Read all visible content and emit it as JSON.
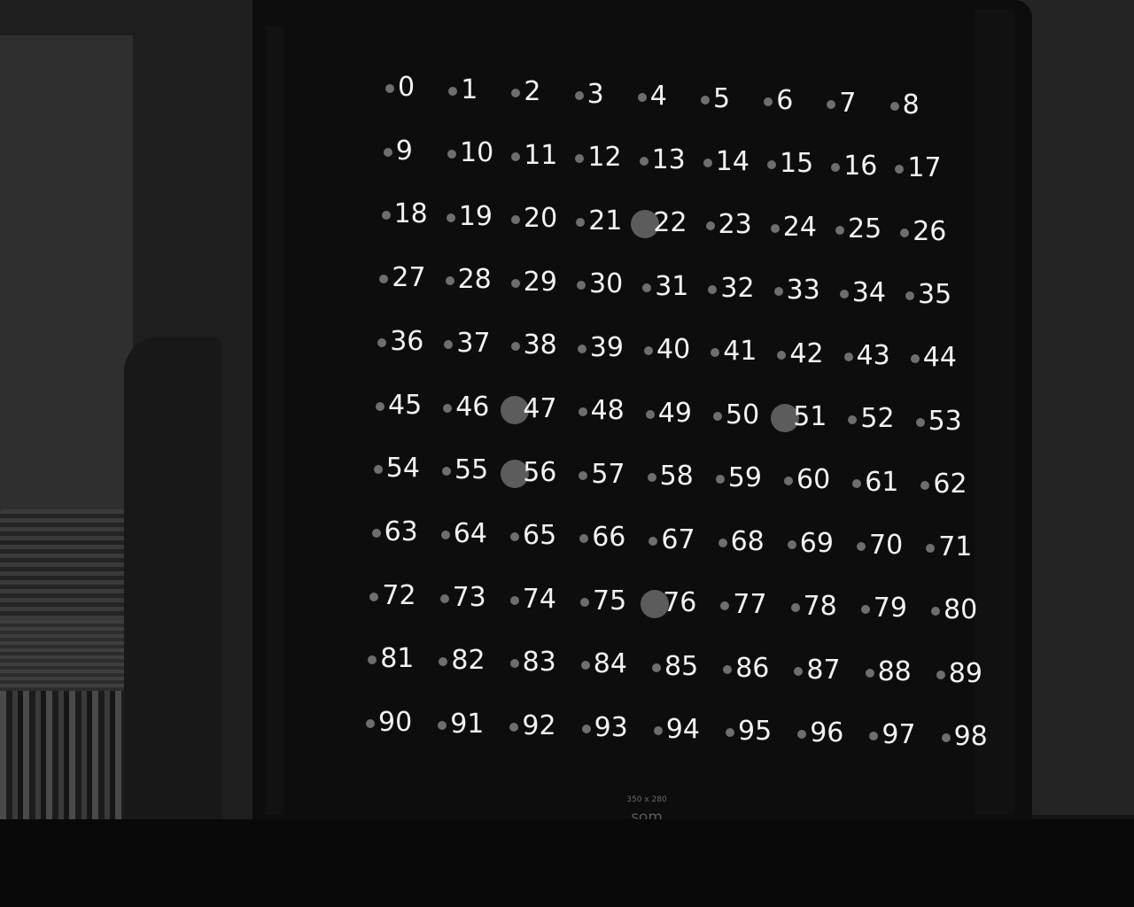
{
  "labels": [
    "0",
    "1",
    "2",
    "3",
    "4",
    "5",
    "6",
    "7",
    "8",
    "9",
    "10",
    "11",
    "12",
    "13",
    "14",
    "15",
    "16",
    "17",
    "18",
    "19",
    "20",
    "21",
    "22",
    "23",
    "24",
    "25",
    "26",
    "27",
    "28",
    "29",
    "30",
    "31",
    "32",
    "33",
    "34",
    "35",
    "36",
    "37",
    "38",
    "39",
    "40",
    "41",
    "42",
    "43",
    "44",
    "45",
    "46",
    "47",
    "48",
    "49",
    "50",
    "51",
    "52",
    "53",
    "54",
    "55",
    "56",
    "57",
    "58",
    "59",
    "60",
    "61",
    "62",
    "63",
    "64",
    "65",
    "66",
    "67",
    "68",
    "69",
    "70",
    "71",
    "72",
    "73",
    "74",
    "75",
    "76",
    "77",
    "78",
    "79",
    "80",
    "81",
    "82",
    "83",
    "84",
    "85",
    "86",
    "87",
    "88",
    "89",
    "90",
    "91",
    "92",
    "93",
    "94",
    "95",
    "96",
    "97",
    "98"
  ],
  "highlighted": [
    "22",
    "47",
    "51",
    "56",
    "76"
  ],
  "board": {
    "size_caption": "350 x 280",
    "logo_text": "som"
  },
  "colors": {
    "board": "#0d0d0d",
    "label": "#f2f2f2",
    "dot": "#6e6e6e",
    "highlight_dot": "#5c5c5c"
  }
}
